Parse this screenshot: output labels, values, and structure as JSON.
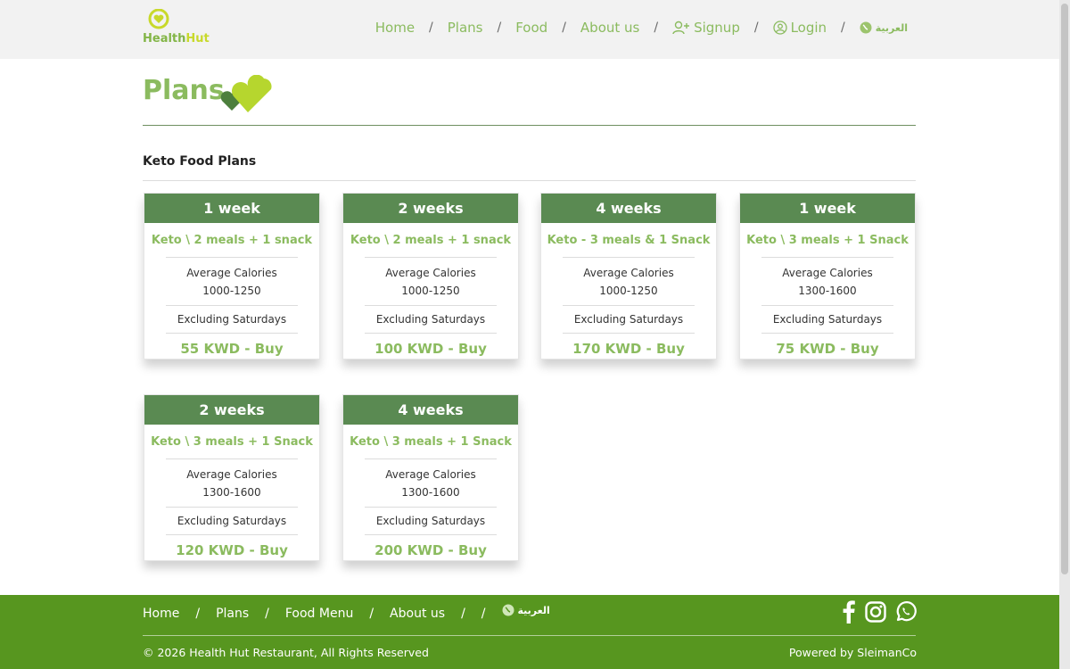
{
  "brand": {
    "logo_word1": "Health",
    "logo_word2": "Hut"
  },
  "nav": {
    "items": [
      "Home",
      "Plans",
      "Food",
      "About us"
    ],
    "signup": "Signup",
    "login": "Login",
    "language": "العربية"
  },
  "page": {
    "title": "Plans",
    "section_title": "Keto Food Plans"
  },
  "cards": [
    {
      "duration": "1 week",
      "plan": "Keto \\ 2 meals + 1 snack",
      "calories_label": "Average Calories",
      "calories": "1000-1250",
      "note": "Excluding Saturdays",
      "price": "55 KWD - Buy"
    },
    {
      "duration": "2 weeks",
      "plan": "Keto \\ 2 meals + 1 snack",
      "calories_label": "Average Calories",
      "calories": "1000-1250",
      "note": "Excluding Saturdays",
      "price": "100 KWD - Buy"
    },
    {
      "duration": "4 weeks",
      "plan": "Keto - 3 meals & 1 Snack",
      "calories_label": "Average Calories",
      "calories": "1000-1250",
      "note": "Excluding Saturdays",
      "price": "170 KWD - Buy"
    },
    {
      "duration": "1 week",
      "plan": "Keto \\ 3 meals + 1 Snack",
      "calories_label": "Average Calories",
      "calories": "1300-1600",
      "note": "Excluding Saturdays",
      "price": "75 KWD - Buy"
    },
    {
      "duration": "2 weeks",
      "plan": "Keto \\ 3 meals + 1 Snack",
      "calories_label": "Average Calories",
      "calories": "1300-1600",
      "note": "Excluding Saturdays",
      "price": "120 KWD - Buy"
    },
    {
      "duration": "4 weeks",
      "plan": "Keto \\ 3 meals + 1 Snack",
      "calories_label": "Average Calories",
      "calories": "1300-1600",
      "note": "Excluding Saturdays",
      "price": "200 KWD - Buy"
    }
  ],
  "footer": {
    "items": [
      "Home",
      "Plans",
      "Food Menu",
      "About us"
    ],
    "language": "العربية",
    "copyright": "© 2026 Health Hut Restaurant, All Rights Reserved",
    "powered": "Powered by SleimanCo",
    "social_icons": [
      "facebook-icon",
      "instagram-icon",
      "whatsapp-icon"
    ]
  },
  "colors": {
    "accent": "#8bbb5f",
    "card_header": "#5a8a52",
    "footer": "#57961f",
    "header_bg": "#f2f2f2"
  }
}
